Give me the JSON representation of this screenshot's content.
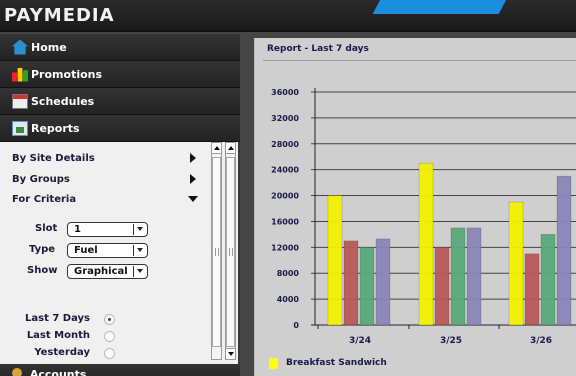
{
  "app": {
    "logo": "PAYMEDIA",
    "accent_color": "#1a8fe0"
  },
  "nav": [
    {
      "label": "Home",
      "icon": "home-icon"
    },
    {
      "label": "Promotions",
      "icon": "bar-chart-icon"
    },
    {
      "label": "Schedules",
      "icon": "calendar-icon"
    },
    {
      "label": "Reports",
      "icon": "report-icon"
    }
  ],
  "criteria": {
    "by_site_details": "By Site Details",
    "by_groups": "By Groups",
    "for_criteria": "For Criteria",
    "slot_label": "Slot",
    "slot_value": "1",
    "type_label": "Type",
    "type_value": "Fuel",
    "show_label": "Show",
    "show_value": "Graphical",
    "ranges": [
      {
        "label": "Last 7 Days",
        "selected": true
      },
      {
        "label": "Last Month",
        "selected": false
      },
      {
        "label": "Yesterday",
        "selected": false
      }
    ]
  },
  "accounts_label": "Accounts",
  "report": {
    "title": "Report - Last 7 days"
  },
  "chart_data": {
    "type": "bar",
    "categories": [
      "3/24",
      "3/25",
      "3/26"
    ],
    "ylim": [
      0,
      36000
    ],
    "yticks": [
      0,
      4000,
      8000,
      12000,
      16000,
      20000,
      24000,
      28000,
      32000,
      36000
    ],
    "series": [
      {
        "name": "Breakfast Sandwich",
        "color": "#f2f200",
        "values": [
          20000,
          25000,
          19000
        ]
      },
      {
        "name": "",
        "color": "#b85a5a",
        "values": [
          13000,
          12000,
          11000
        ]
      },
      {
        "name": "",
        "color": "#5aaa7a",
        "values": [
          12000,
          15000,
          14000
        ]
      },
      {
        "name": "",
        "color": "#8a86b8",
        "values": [
          13300,
          15000,
          23000
        ]
      }
    ],
    "legend": [
      "Breakfast Sandwich"
    ],
    "grid": true
  }
}
